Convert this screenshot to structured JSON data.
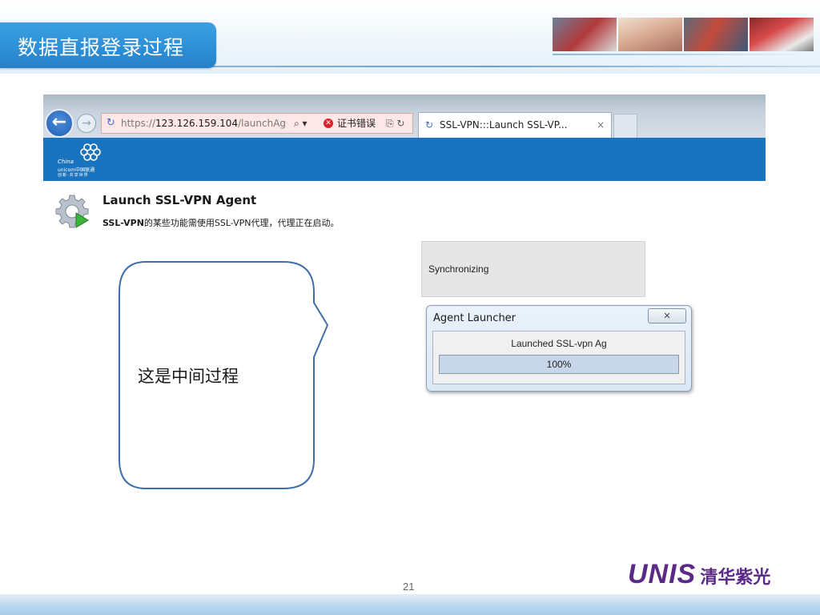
{
  "slide": {
    "title": "数据直报登录过程",
    "page_number": "21",
    "logo_text": "UNIS",
    "logo_cn": "清华紫光"
  },
  "browser": {
    "address_bar": {
      "scheme": "https://",
      "host": "123.126.159.104",
      "path": "/launchAg",
      "search_icon": "⌕ ▾",
      "error_text": "证书错误",
      "tool_icons": "⎘ ↻"
    },
    "tab": {
      "label": "SSL-VPN:::Launch SSL-VP...",
      "close": "×"
    },
    "header_logo": {
      "line1": "China",
      "line2": "unicom中国联通",
      "line3": "创新·共享世界"
    }
  },
  "page": {
    "heading": "Launch SSL-VPN Agent",
    "desc_bold": "SSL-VPN",
    "desc_rest": "的某些功能需使用SSL-VPN代理，代理正在启动。",
    "sync_status": "Synchronizing"
  },
  "dialog": {
    "title": "Agent Launcher",
    "close_label": "✕",
    "message": "Launched SSL-vpn Ag­",
    "progress_label": "100%",
    "progress_value": 1.0
  },
  "callout": {
    "text": "这是中间过程"
  },
  "colors": {
    "title_tab": "#2e90d7",
    "browser_band": "#1a73be",
    "logo": "#5b2a86"
  }
}
